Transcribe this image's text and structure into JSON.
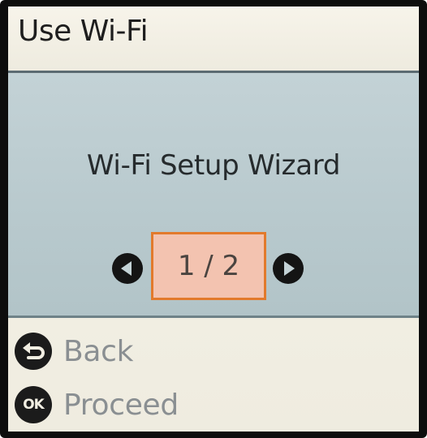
{
  "header": {
    "title": "Use Wi-Fi"
  },
  "main": {
    "heading": "Wi-Fi Setup Wizard",
    "pager": {
      "current": 1,
      "total": 2,
      "label": "1 / 2",
      "prev_icon": "left-arrow-icon",
      "next_icon": "right-arrow-icon"
    }
  },
  "footer": {
    "back": {
      "icon": "back-icon",
      "label": "Back"
    },
    "proceed": {
      "icon": "ok-icon",
      "icon_text": "OK",
      "label": "Proceed"
    }
  },
  "colors": {
    "title_bg": "#f2efe3",
    "panel_bg": "#b8c9cd",
    "highlight_fill": "#f3c3b0",
    "highlight_border": "#e27a2c",
    "text_dark": "#262b2d",
    "text_disabled": "#8a8f92"
  }
}
